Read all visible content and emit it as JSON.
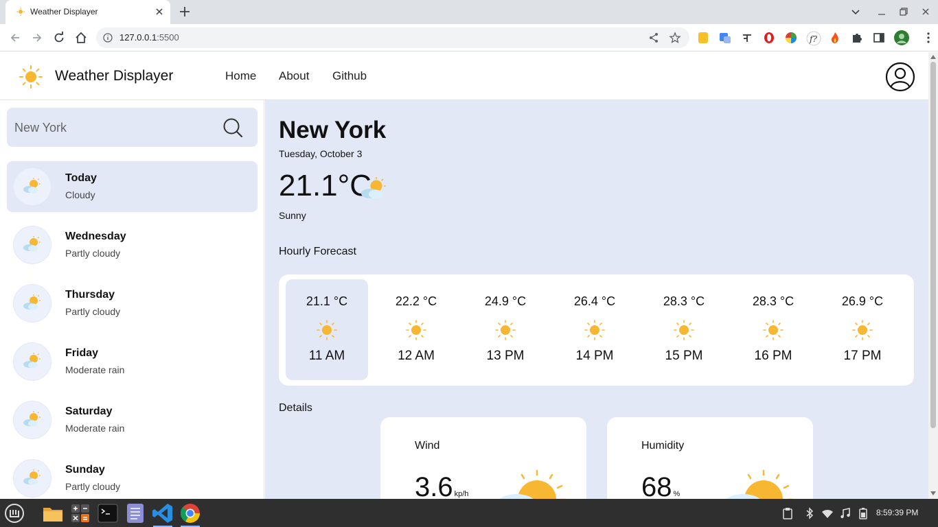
{
  "browser": {
    "tab_title": "Weather Displayer",
    "url_host": "127.0.0.1",
    "url_port": ":5500"
  },
  "app": {
    "brand": "Weather Displayer",
    "nav": [
      "Home",
      "About",
      "Github"
    ]
  },
  "search": {
    "placeholder": "New York"
  },
  "forecast_days": [
    {
      "name": "Today",
      "condition": "Cloudy"
    },
    {
      "name": "Wednesday",
      "condition": "Partly cloudy"
    },
    {
      "name": "Thursday",
      "condition": "Partly cloudy"
    },
    {
      "name": "Friday",
      "condition": "Moderate rain"
    },
    {
      "name": "Saturday",
      "condition": "Moderate rain"
    },
    {
      "name": "Sunday",
      "condition": "Partly cloudy"
    }
  ],
  "current": {
    "city": "New York",
    "date": "Tuesday, October 3",
    "temperature": "21.1°C",
    "condition": "Sunny"
  },
  "hourly": {
    "title": "Hourly Forecast",
    "items": [
      {
        "temp": "21.1 °C",
        "time": "11 AM"
      },
      {
        "temp": "22.2 °C",
        "time": "12 AM"
      },
      {
        "temp": "24.9 °C",
        "time": "13 PM"
      },
      {
        "temp": "26.4 °C",
        "time": "14 PM"
      },
      {
        "temp": "28.3 °C",
        "time": "15 PM"
      },
      {
        "temp": "28.3 °C",
        "time": "16 PM"
      },
      {
        "temp": "26.9 °C",
        "time": "17 PM"
      }
    ]
  },
  "details": {
    "title": "Details",
    "wind": {
      "label": "Wind",
      "value": "3.6",
      "unit": "kp/h"
    },
    "humidity": {
      "label": "Humidity",
      "value": "68",
      "unit": "%"
    }
  },
  "taskbar": {
    "clock": "8:59:39 PM"
  },
  "colors": {
    "panel": "#e3e8f6",
    "sun": "#f7b733",
    "taskbar": "#2f2f2f"
  }
}
